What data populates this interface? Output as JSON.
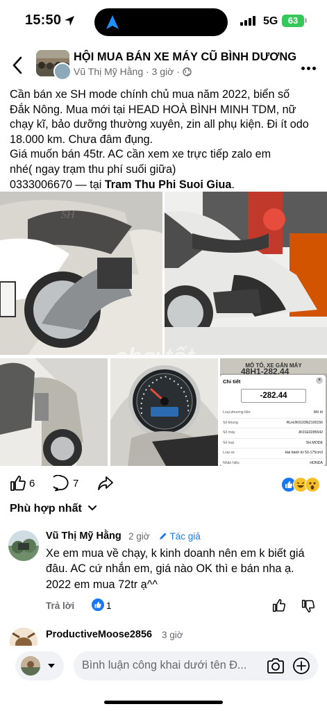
{
  "status_bar": {
    "time": "15:50",
    "network": "5G",
    "battery": "63"
  },
  "header": {
    "group_name": "HỘI MUA BÁN XE MÁY CŨ BÌNH DƯƠNG",
    "author": "Vũ Thị Mỹ Hằng",
    "time": "3 giờ"
  },
  "post": {
    "lines": [
      "Cần bán xe SH mode chính chủ mua năm 2022, biển số",
      "Đắk Nông.  Mua mới tại HEAD HOÀ BÌNH MINH TDM, nữ",
      "chạy kĩ, bảo dưỡng thường xuyên, zin all phụ kiện. Đi ít odo",
      "18.000 km. Chưa đâm đụng.",
      "Giá muốn bán 45tr. AC cần xem xe trực tiếp zalo em",
      "nhé( ngay trạm thu phí suối giữa)"
    ],
    "phone": "0333006670",
    "location_sep": " — tại ",
    "location": "Tram Thu Phi Suoi Giua",
    "location_end": "."
  },
  "photos": {
    "watermark": "chợ tốt",
    "registration": {
      "top_banner": "MÔ TÔ, XE GẮN MÁY",
      "top_plate": "48H1-282.44",
      "title": "Chi tiết",
      "plate": "-282.44",
      "rows": [
        {
          "label": "Loại phương tiện",
          "value": "Mô tô"
        },
        {
          "label": "Số khung",
          "value": "RLHJK0103NZ100156"
        },
        {
          "label": "Số máy",
          "value": "JK01E0285542"
        },
        {
          "label": "Số loại",
          "value": "SH MODE"
        },
        {
          "label": "Loại xe",
          "value": "Hai bánh từ 50-175cm3"
        },
        {
          "label": "Nhãn hiệu",
          "value": "HONDA"
        }
      ]
    }
  },
  "actions": {
    "likes": "6",
    "comments": "7"
  },
  "comments_sort": "Phù hợp nhất",
  "comment1": {
    "author": "Vũ Thị Mỹ Hằng",
    "time": "2 giờ",
    "badge": "Tác giả",
    "text": "Xe em mua về chạy, k kinh doanh nên em k biết giá đâu. AC cứ nhắn em, giá nào OK thì e bán nha ạ. 2022 em mua 72tr ạ^^",
    "reply_label": "Trả lời",
    "like_count": "1"
  },
  "comment2": {
    "author": "ProductiveMoose2856",
    "time": "3 giờ"
  },
  "composer": {
    "placeholder": "Bình luận công khai dưới tên Đ..."
  },
  "colors": {
    "accent": "#1877f2",
    "secondary_text": "#65676b",
    "battery": "#34c759"
  }
}
